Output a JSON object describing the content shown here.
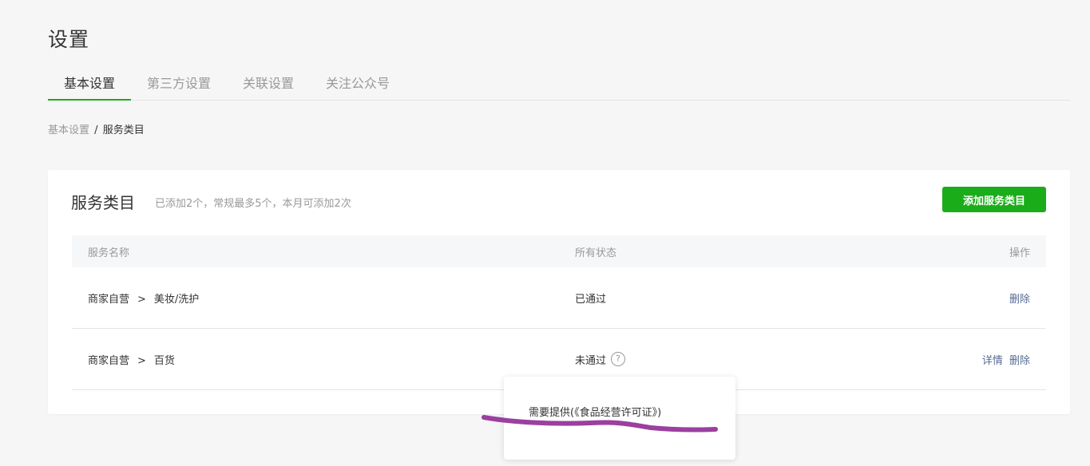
{
  "page": {
    "title": "设置"
  },
  "tabs": [
    {
      "label": "基本设置",
      "active": true
    },
    {
      "label": "第三方设置",
      "active": false
    },
    {
      "label": "关联设置",
      "active": false
    },
    {
      "label": "关注公众号",
      "active": false
    }
  ],
  "breadcrumb": {
    "parent": "基本设置",
    "separator": "/",
    "current": "服务类目"
  },
  "card": {
    "title": "服务类目",
    "subtitle": "已添加2个，常规最多5个，本月可添加2次",
    "add_button": "添加服务类目"
  },
  "table": {
    "headers": {
      "name": "服务名称",
      "status": "所有状态",
      "action": "操作"
    },
    "rows": [
      {
        "category": "商家自营",
        "arrow": ">",
        "sub": "美妆/洗护",
        "status": "已通过",
        "detail": "",
        "delete": "删除"
      },
      {
        "category": "商家自营",
        "arrow": ">",
        "sub": "百货",
        "status": "未通过",
        "detail": "详情",
        "delete": "删除"
      }
    ]
  },
  "popover": {
    "text": "需要提供(《食品经营许可证》)"
  },
  "icons": {
    "help": "question-icon",
    "help_glyph": "?"
  },
  "colors": {
    "accent": "#1aad19",
    "link": "#576b95",
    "annotation": "#9b3fa0"
  }
}
